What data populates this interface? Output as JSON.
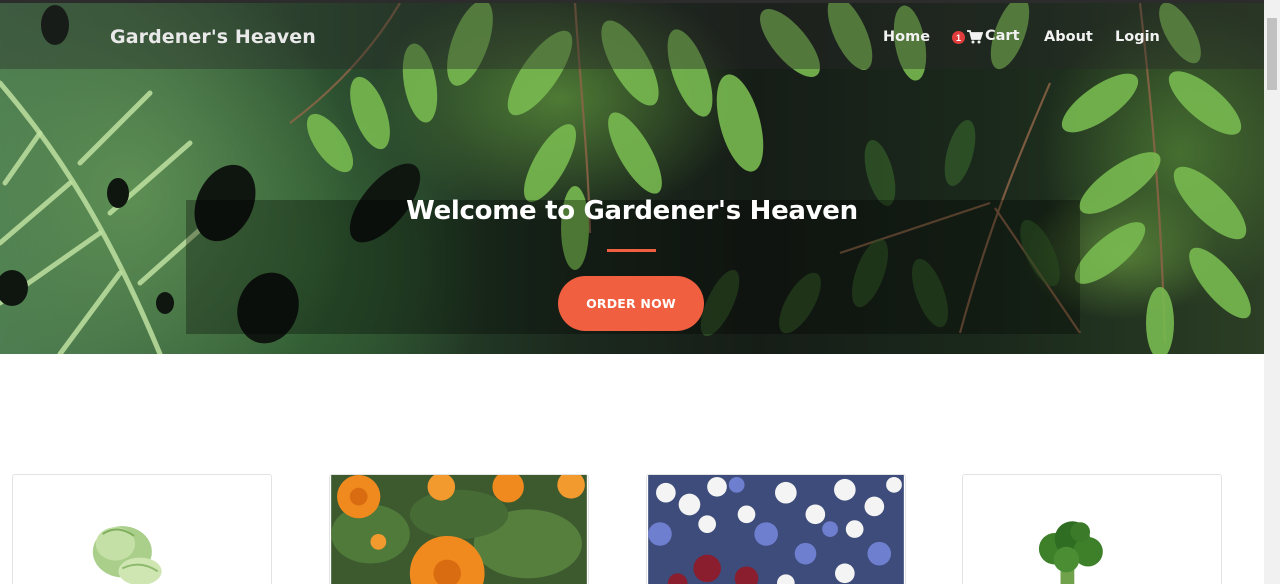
{
  "navbar": {
    "brand": "Gardener's Heaven",
    "links": {
      "home": "Home",
      "cart": "Cart",
      "cart_count": "1",
      "about": "About",
      "login": "Login"
    }
  },
  "hero": {
    "title": "Welcome to Gardener's Heaven",
    "button_label": "ORDER NOW",
    "accent_color": "#f05f40"
  },
  "products": [
    {
      "image": "cabbage-photo"
    },
    {
      "image": "orange-marigold-flowers-photo"
    },
    {
      "image": "white-blue-flowers-photo"
    },
    {
      "image": "broccoli-photo"
    }
  ]
}
